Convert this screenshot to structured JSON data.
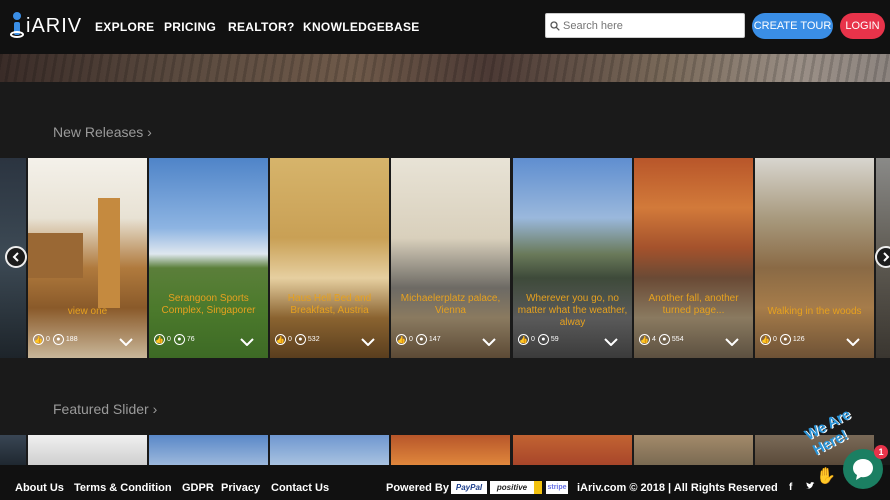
{
  "brand": {
    "name": "iARIV"
  },
  "nav": {
    "links": [
      "EXPLORE",
      "PRICING",
      "REALTOR?",
      "KNOWLEDGEBASE"
    ]
  },
  "search": {
    "placeholder": "Search here"
  },
  "buttons": {
    "create_tour": "CREATE TOUR",
    "login": "LOGIN"
  },
  "sections": {
    "new_releases": "New Releases ›",
    "featured_slider": "Featured Slider ›"
  },
  "cards": [
    {
      "title": "view one",
      "likes": "0",
      "views": "188",
      "icon": "thumbs-up-icon"
    },
    {
      "title": "Serangoon Sports Complex, Singaporer",
      "likes": "0",
      "views": "76",
      "icon": "thumbs-up-icon"
    },
    {
      "title": "Haus Hell Bed and Breakfast, Austria",
      "likes": "0",
      "views": "532",
      "icon": "thumbs-up-icon"
    },
    {
      "title": "Michaelerplatz palace, Vienna",
      "likes": "0",
      "views": "147",
      "icon": "thumbs-up-icon"
    },
    {
      "title": "Wherever you go, no matter what the weather, alway",
      "likes": "0",
      "views": "59",
      "icon": "thumbs-up-icon"
    },
    {
      "title": "Another fall, another turned page...",
      "likes": "4",
      "views": "554",
      "icon": "thumbs-up-icon"
    },
    {
      "title": "Walking in the woods",
      "likes": "0",
      "views": "126",
      "icon": "thumbs-up-icon"
    }
  ],
  "footer": {
    "links": [
      "About Us",
      "Terms & Condition",
      "GDPR",
      "Privacy",
      "Contact Us"
    ],
    "powered_by": "Powered By",
    "payment_logos": [
      "PayPal",
      "positive",
      "stripe"
    ],
    "copyright": "iAriv.com © 2018 | All Rights Reserved"
  },
  "chat": {
    "label": "We Are Here!",
    "badge": "1"
  },
  "colors": {
    "accent_blue": "#3a8ee6",
    "accent_red": "#e8334a",
    "title_orange": "#e6a11f",
    "chat_green": "#1b7f62"
  }
}
